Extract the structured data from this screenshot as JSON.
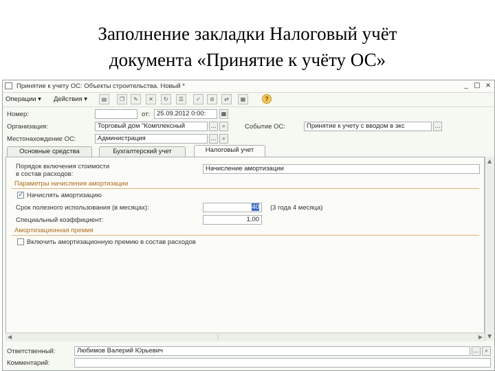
{
  "slide": {
    "title_line1": "Заполнение закладки Налоговый учёт",
    "title_line2": "документа «Принятие к учёту ОС»"
  },
  "window": {
    "title": "Принятие к учету ОС: Объекты строительства. Новый *",
    "minimize": "_",
    "maximize": "□",
    "close": "×"
  },
  "toolbar": {
    "operations": "Операции ▾",
    "actions": "Действия ▾"
  },
  "header": {
    "number_label": "Номер:",
    "number_value": "",
    "date_label": "от:",
    "date_value": "25.09.2012  0:00:",
    "org_label": "Организация:",
    "org_value": "Торговый дом \"Комплексный",
    "event_label": "Событие ОС:",
    "event_value": "Принятие к учету с вводом в экс",
    "location_label": "Местонахождение ОС:",
    "location_value": "Администрация"
  },
  "tabs": [
    {
      "label": "Основные средства"
    },
    {
      "label": "Бухгалтерский учет"
    },
    {
      "label": "Налоговый учет"
    }
  ],
  "tax": {
    "cost_label_1": "Порядок включения стоимости",
    "cost_label_2": "в состав расходов:",
    "cost_value": "Начисление амортизации",
    "section_params": "Параметры начисления амортизации",
    "accrue_label": "Начислять амортизацию",
    "accrue_checked": true,
    "life_label": "Срок полезного использования (в месяцах):",
    "life_value": "40",
    "life_hint": "(3 года 4 месяца)",
    "coef_label": "Специальный коэффициент:",
    "coef_value": "1,00",
    "section_premium": "Амортизационная премия",
    "premium_label": "Включить амортизационную премию в состав расходов",
    "premium_checked": false
  },
  "footer": {
    "responsible_label": "Ответственный:",
    "responsible_value": "Любимов Валерий Юрьевич",
    "comment_label": "Комментарий:",
    "comment_value": ""
  },
  "colors": {
    "section": "#b06a1a",
    "window_bg": "#f6f8f2",
    "field_border": "#a8b1b4"
  }
}
